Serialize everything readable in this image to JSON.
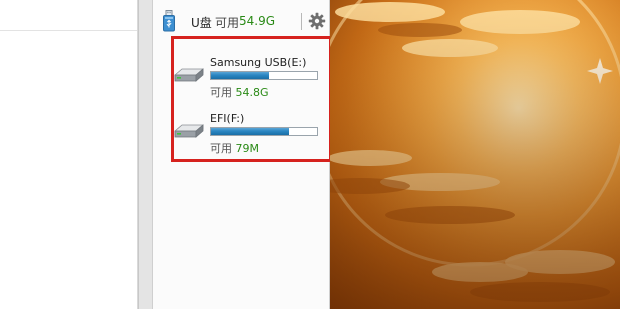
{
  "widget": {
    "header": {
      "title": "U盘",
      "available_label": "可用",
      "available_value": "54.9G",
      "icon": "usb-drive-icon",
      "settings_icon": "gear-icon"
    },
    "drives": [
      {
        "name": "Samsung USB(E:)",
        "available_label": "可用",
        "available_value": "54.8G",
        "usage_fraction": 0.55,
        "icon": "removable-drive-icon"
      },
      {
        "name": "EFI(F:)",
        "available_label": "可用",
        "available_value": "79M",
        "usage_fraction": 0.74,
        "icon": "removable-drive-icon"
      }
    ]
  },
  "colors": {
    "available_green": "#2a8a16",
    "highlight_red": "#d6221e",
    "bar_blue": "#2b86c2"
  }
}
